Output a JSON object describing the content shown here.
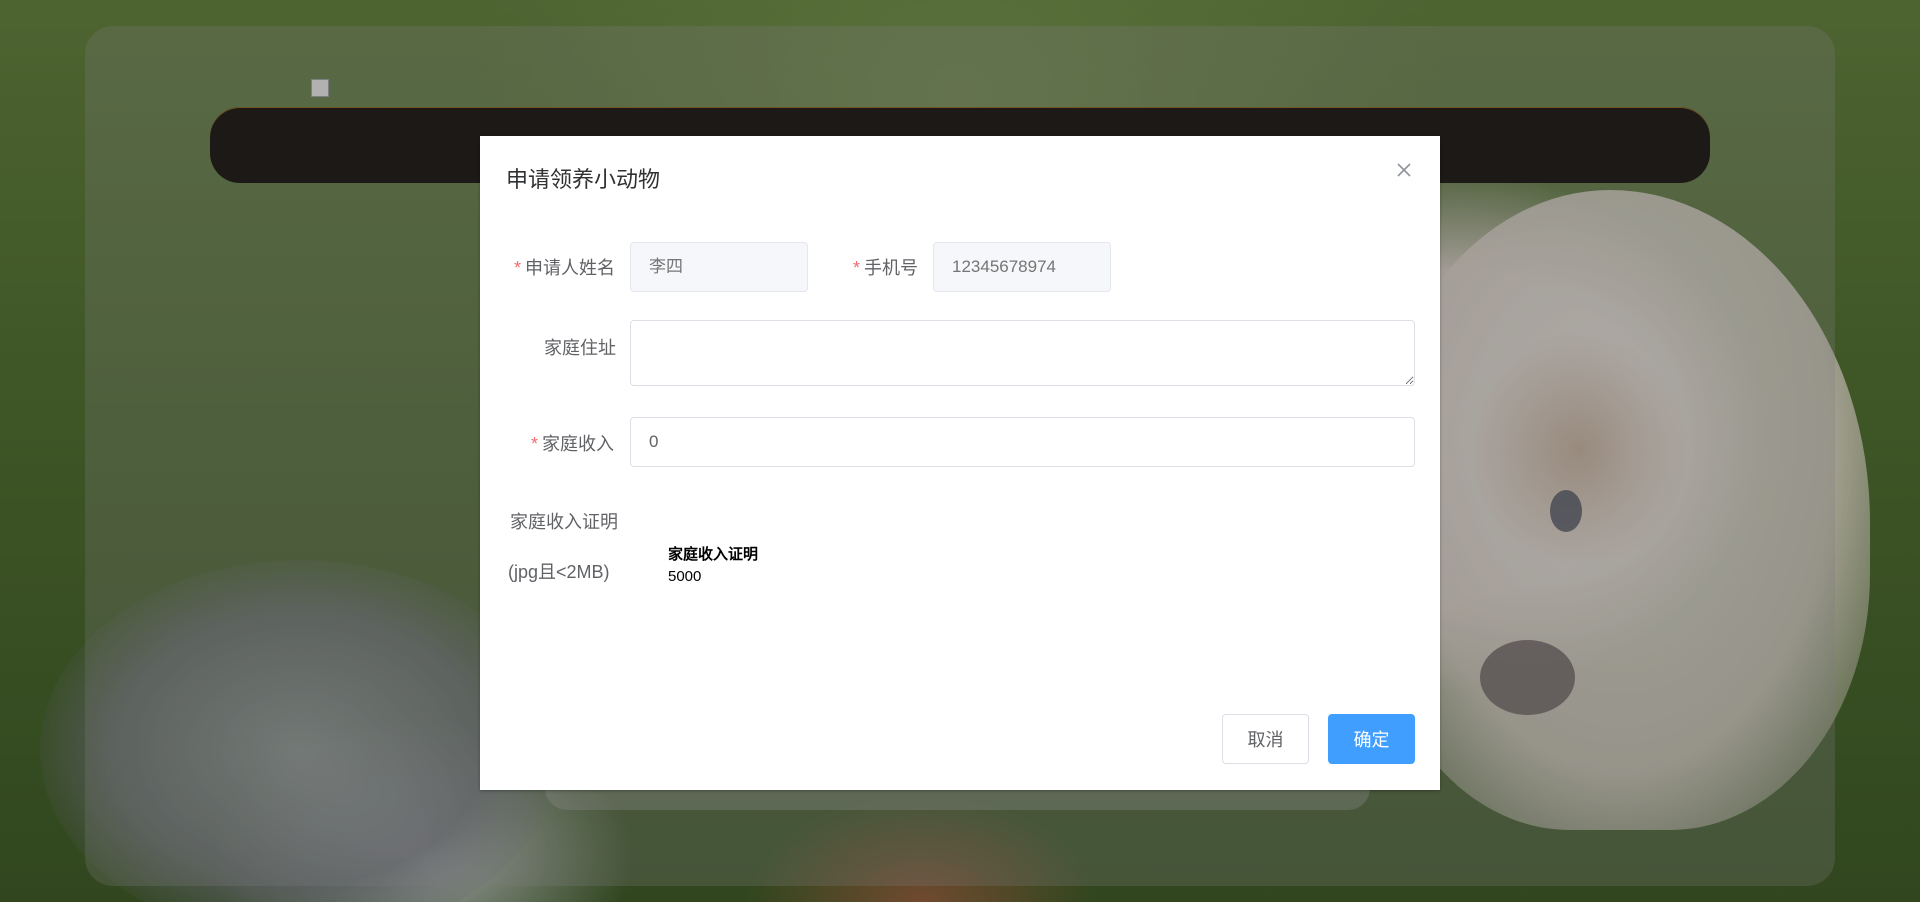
{
  "dialog": {
    "title": "申请领养小动物",
    "close_icon": "close-icon"
  },
  "form": {
    "name": {
      "label": "申请人姓名",
      "placeholder": "李四",
      "required": true,
      "disabled": true
    },
    "phone": {
      "label": "手机号",
      "placeholder": "12345678974",
      "required": true,
      "disabled": true
    },
    "address": {
      "label": "家庭住址",
      "value": ""
    },
    "income": {
      "label": "家庭收入",
      "value": "0",
      "required": true
    },
    "proof": {
      "label_line1": "家庭收入证明",
      "label_line2": "(jpg且<2MB)",
      "file_title": "家庭收入证明",
      "file_value": "5000"
    },
    "required_mark": "*"
  },
  "footer": {
    "cancel_label": "取消",
    "confirm_label": "确定"
  },
  "colors": {
    "primary": "#409eff",
    "required": "#f56c6c"
  }
}
